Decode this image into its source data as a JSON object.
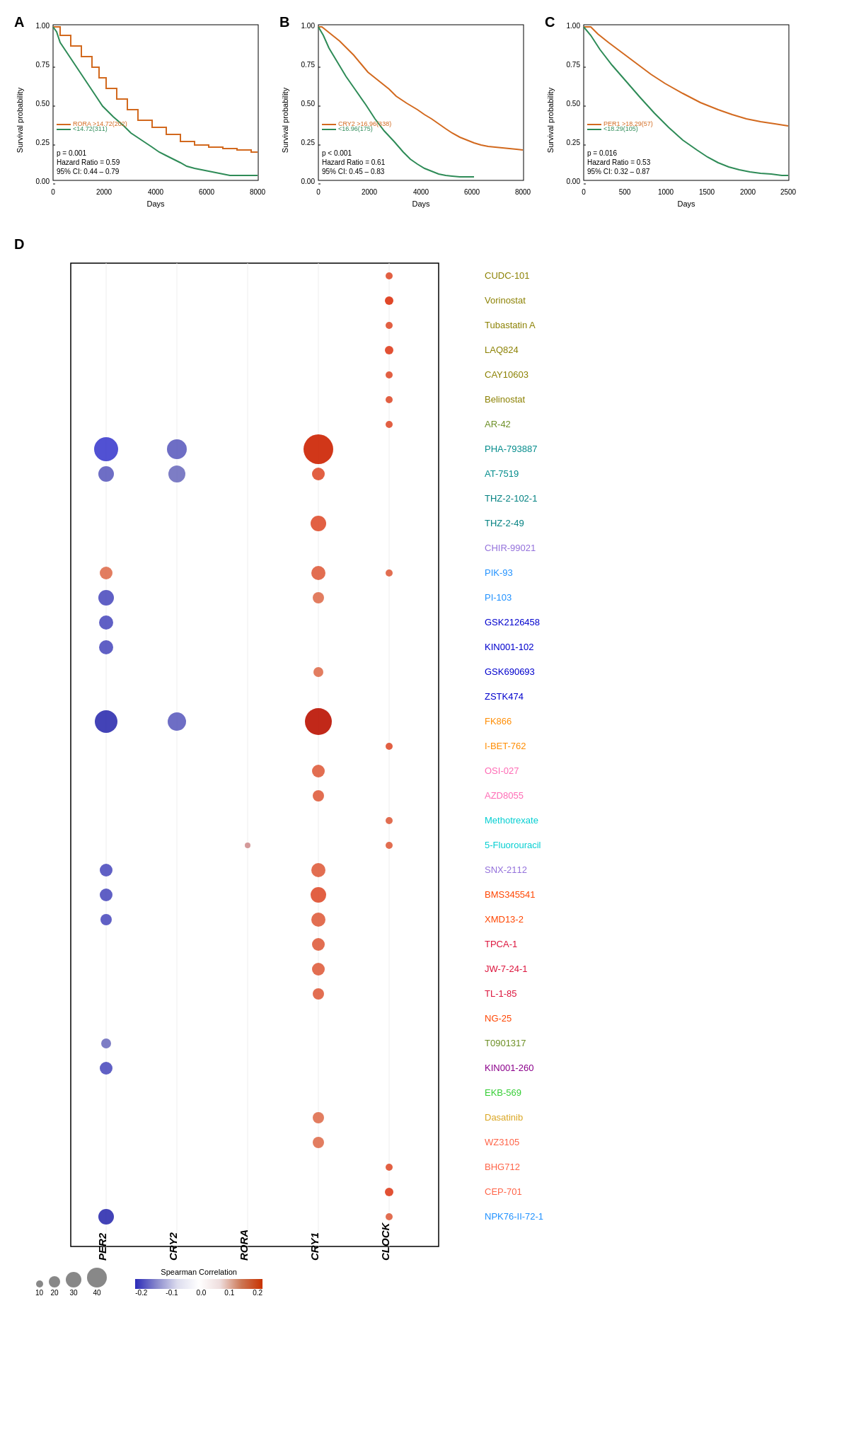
{
  "panels": {
    "A": {
      "label": "A",
      "gene": "RORA",
      "high_label": ">14.72(202)",
      "low_label": "<14.72(311)",
      "p_value": "p = 0.001",
      "hazard_ratio": "Hazard Ratio = 0.59",
      "ci": "95% CI: 0.44 – 0.79",
      "x_axis": "Days",
      "x_ticks": [
        "0",
        "2000",
        "4000",
        "6000",
        "8000"
      ]
    },
    "B": {
      "label": "B",
      "gene": "CRY2",
      "high_label": ">16.96(338)",
      "low_label": "<16.96(175)",
      "p_value": "p < 0.001",
      "hazard_ratio": "Hazard Ratio = 0.61",
      "ci": "95% CI: 0.45 – 0.83",
      "x_axis": "Days",
      "x_ticks": [
        "0",
        "2000",
        "4000",
        "6000",
        "8000"
      ]
    },
    "C": {
      "label": "C",
      "gene": "PER1",
      "high_label": ">18.29(57)",
      "low_label": "<18.29(105)",
      "p_value": "p = 0.016",
      "hazard_ratio": "Hazard Ratio = 0.53",
      "ci": "95% CI: 0.32 – 0.87",
      "x_axis": "Days",
      "x_ticks": [
        "0",
        "500",
        "1000",
        "1500",
        "2000",
        "2500"
      ]
    },
    "D": {
      "label": "D",
      "x_labels": [
        "PER2",
        "CRY2",
        "RORA",
        "CRY1",
        "CLOCK"
      ],
      "y_labels": [
        "CUDC-101",
        "Vorinostat",
        "Tubastatin A",
        "LAQ824",
        "CAY10603",
        "Belinostat",
        "AR-42",
        "PHA-793887",
        "AT-7519",
        "THZ-2-102-1",
        "THZ-2-49",
        "CHIR-99021",
        "PIK-93",
        "PI-103",
        "GSK2126458",
        "KIN001-102",
        "GSK690693",
        "ZSTK474",
        "FK866",
        "I-BET-762",
        "OSI-027",
        "AZD8055",
        "Methotrexate",
        "5-Fluorouracil",
        "SNX-2112",
        "BMS345541",
        "XMD13-2",
        "TPCA-1",
        "JW-7-24-1",
        "TL-1-85",
        "NG-25",
        "T0901317",
        "KIN001-260",
        "EKB-569",
        "Dasatinib",
        "WZ3105",
        "BHG712",
        "CEP-701",
        "NPK76-II-72-1"
      ],
      "drug_colors": [
        "#8B8000",
        "#8B8000",
        "#8B8000",
        "#8B8000",
        "#8B8000",
        "#8B8000",
        "#6B8E23",
        "#008B8B",
        "#008B8B",
        "#008080",
        "#008080",
        "#9370DB",
        "#1E90FF",
        "#1E90FF",
        "#0000CD",
        "#0000CD",
        "#0000CD",
        "#0000CD",
        "#FF8C00",
        "#FF8C00",
        "#FF69B4",
        "#FF69B4",
        "#00CED1",
        "#00CED1",
        "#9370DB",
        "#FF4500",
        "#FF4500",
        "#DC143C",
        "#DC143C",
        "#DC143C",
        "#FF4500",
        "#6B8E23",
        "#8B008B",
        "#32CD32",
        "#DAA520",
        "#FF6347",
        "#FF6347",
        "#FF6347",
        "#1E90FF"
      ],
      "bubbles": [
        {
          "x": 0,
          "y": 7,
          "size": 35,
          "color": "#3333aa",
          "sign": -1
        },
        {
          "x": 0,
          "y": 8,
          "size": 22,
          "color": "#5555bb",
          "sign": -1
        },
        {
          "x": 0,
          "y": 12,
          "size": 18,
          "color": "#cc6644",
          "sign": 1
        },
        {
          "x": 0,
          "y": 13,
          "size": 22,
          "color": "#5555bb",
          "sign": -1
        },
        {
          "x": 0,
          "y": 14,
          "size": 20,
          "color": "#5555bb",
          "sign": -1
        },
        {
          "x": 0,
          "y": 15,
          "size": 20,
          "color": "#5555bb",
          "sign": -1
        },
        {
          "x": 0,
          "y": 18,
          "size": 32,
          "color": "#2222aa",
          "sign": -1
        },
        {
          "x": 0,
          "y": 24,
          "size": 18,
          "color": "#5555bb",
          "sign": -1
        },
        {
          "x": 0,
          "y": 25,
          "size": 18,
          "color": "#5555bb",
          "sign": -1
        },
        {
          "x": 0,
          "y": 26,
          "size": 16,
          "color": "#5555bb",
          "sign": -1
        },
        {
          "x": 0,
          "y": 31,
          "size": 14,
          "color": "#7777cc",
          "sign": -1
        },
        {
          "x": 0,
          "y": 32,
          "size": 18,
          "color": "#5555bb",
          "sign": -1
        },
        {
          "x": 0,
          "y": 38,
          "size": 22,
          "color": "#3333aa",
          "sign": -1
        },
        {
          "x": 1,
          "y": 7,
          "size": 28,
          "color": "#5555bb",
          "sign": -1
        },
        {
          "x": 1,
          "y": 8,
          "size": 24,
          "color": "#6666bb",
          "sign": -1
        },
        {
          "x": 1,
          "y": 18,
          "size": 26,
          "color": "#6666bb",
          "sign": -1
        },
        {
          "x": 2,
          "y": 23,
          "size": 8,
          "color": "#cc8888",
          "sign": 1
        },
        {
          "x": 3,
          "y": 7,
          "size": 42,
          "color": "#cc3300",
          "sign": 1
        },
        {
          "x": 3,
          "y": 8,
          "size": 18,
          "color": "#dd5533",
          "sign": 1
        },
        {
          "x": 3,
          "y": 10,
          "size": 22,
          "color": "#dd5533",
          "sign": 1
        },
        {
          "x": 3,
          "y": 12,
          "size": 20,
          "color": "#dd5533",
          "sign": 1
        },
        {
          "x": 3,
          "y": 13,
          "size": 16,
          "color": "#dd6644",
          "sign": 1
        },
        {
          "x": 3,
          "y": 16,
          "size": 14,
          "color": "#dd6644",
          "sign": 1
        },
        {
          "x": 3,
          "y": 18,
          "size": 38,
          "color": "#cc2200",
          "sign": 1
        },
        {
          "x": 3,
          "y": 20,
          "size": 18,
          "color": "#dd5533",
          "sign": 1
        },
        {
          "x": 3,
          "y": 21,
          "size": 16,
          "color": "#dd5533",
          "sign": 1
        },
        {
          "x": 3,
          "y": 24,
          "size": 20,
          "color": "#dd5533",
          "sign": 1
        },
        {
          "x": 3,
          "y": 25,
          "size": 22,
          "color": "#dd4422",
          "sign": 1
        },
        {
          "x": 3,
          "y": 26,
          "size": 20,
          "color": "#dd5533",
          "sign": 1
        },
        {
          "x": 3,
          "y": 27,
          "size": 18,
          "color": "#dd5533",
          "sign": 1
        },
        {
          "x": 3,
          "y": 28,
          "size": 18,
          "color": "#dd5533",
          "sign": 1
        },
        {
          "x": 3,
          "y": 29,
          "size": 16,
          "color": "#dd5533",
          "sign": 1
        },
        {
          "x": 3,
          "y": 34,
          "size": 16,
          "color": "#dd6644",
          "sign": 1
        },
        {
          "x": 3,
          "y": 35,
          "size": 16,
          "color": "#dd6644",
          "sign": 1
        },
        {
          "x": 4,
          "y": 0,
          "size": 8,
          "color": "#dd4422",
          "sign": 1
        },
        {
          "x": 4,
          "y": 3,
          "size": 12,
          "color": "#dd4422",
          "sign": 1
        },
        {
          "x": 4,
          "y": 6,
          "size": 10,
          "color": "#dd4422",
          "sign": 1
        },
        {
          "x": 4,
          "y": 12,
          "size": 10,
          "color": "#dd5533",
          "sign": 1
        },
        {
          "x": 4,
          "y": 19,
          "size": 10,
          "color": "#dd4422",
          "sign": 1
        },
        {
          "x": 4,
          "y": 22,
          "size": 10,
          "color": "#dd5533",
          "sign": 1
        },
        {
          "x": 4,
          "y": 23,
          "size": 10,
          "color": "#dd5533",
          "sign": 1
        },
        {
          "x": 4,
          "y": 36,
          "size": 10,
          "color": "#dd4422",
          "sign": 1
        },
        {
          "x": 4,
          "y": 37,
          "size": 12,
          "color": "#dd4422",
          "sign": 1
        },
        {
          "x": 4,
          "y": 38,
          "size": 10,
          "color": "#dd5533",
          "sign": 1
        }
      ]
    }
  },
  "legend": {
    "size_values": [
      "10",
      "20",
      "30",
      "40"
    ],
    "color_label": "Spearman Correlation",
    "color_ticks": [
      "-0.2",
      "-0.1",
      "0.0",
      "0.1",
      "0.2"
    ],
    "y_axis_label": "Survival probability"
  }
}
